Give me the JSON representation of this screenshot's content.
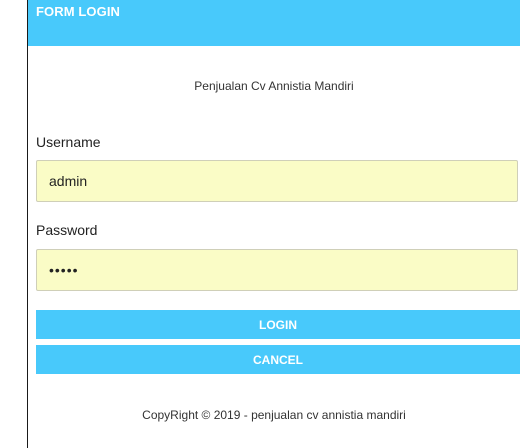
{
  "form": {
    "title": "FORM LOGIN",
    "subtitle": "Penjualan Cv Annistia Mandiri",
    "username_label": "Username",
    "username_value": "admin",
    "password_label": "Password",
    "password_value": "admin",
    "login_label": "LOGIN",
    "cancel_label": "CANCEL",
    "footer": "CopyRight © 2019 - penjualan cv annistia mandiri"
  },
  "colors": {
    "accent": "#48c9fb",
    "input_background": "#fafcc6",
    "button_text": "#ffffff"
  }
}
